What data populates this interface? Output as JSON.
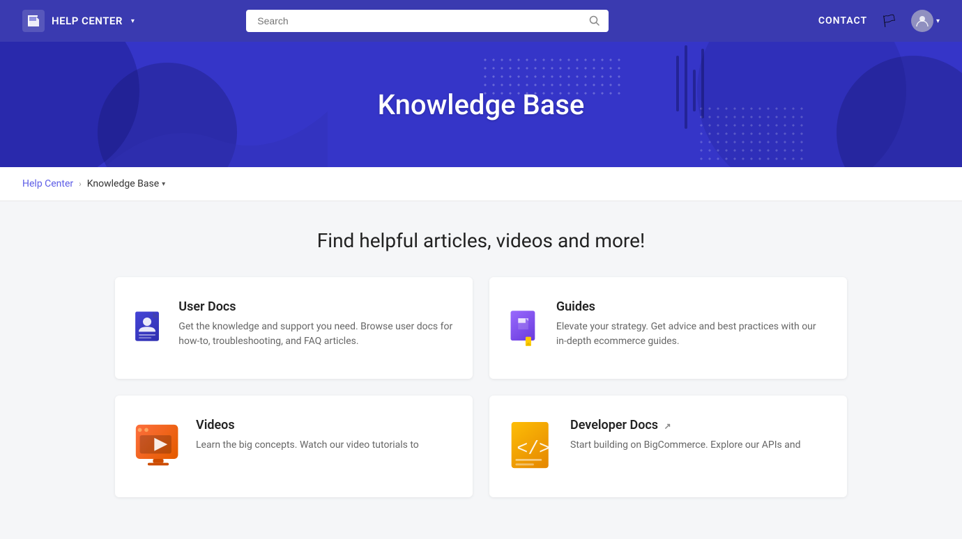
{
  "navbar": {
    "brand": "HELP CENTER",
    "brand_caret": "▾",
    "search_placeholder": "Search",
    "contact_label": "CONTACT",
    "avatar_caret": "▾"
  },
  "breadcrumb": {
    "home_label": "Help Center",
    "separator": "›",
    "current_label": "Knowledge Base",
    "current_caret": "▾"
  },
  "hero": {
    "title": "Knowledge Base"
  },
  "main": {
    "find_title": "Find helpful articles, videos and more!",
    "cards": [
      {
        "id": "user-docs",
        "title": "User Docs",
        "description": "Get the knowledge and support you need. Browse user docs for how-to, troubleshooting, and FAQ articles.",
        "external": false
      },
      {
        "id": "guides",
        "title": "Guides",
        "description": "Elevate your strategy. Get advice and best practices with our in-depth ecommerce guides.",
        "external": false
      },
      {
        "id": "videos",
        "title": "Videos",
        "description": "Learn the big concepts. Watch our video tutorials to",
        "external": false
      },
      {
        "id": "developer-docs",
        "title": "Developer Docs",
        "description": "Start building on BigCommerce. Explore our APIs and",
        "external": true
      }
    ]
  },
  "colors": {
    "primary": "#3535c8",
    "navbar_bg": "#3a3ab0",
    "link": "#5c5ce6"
  }
}
